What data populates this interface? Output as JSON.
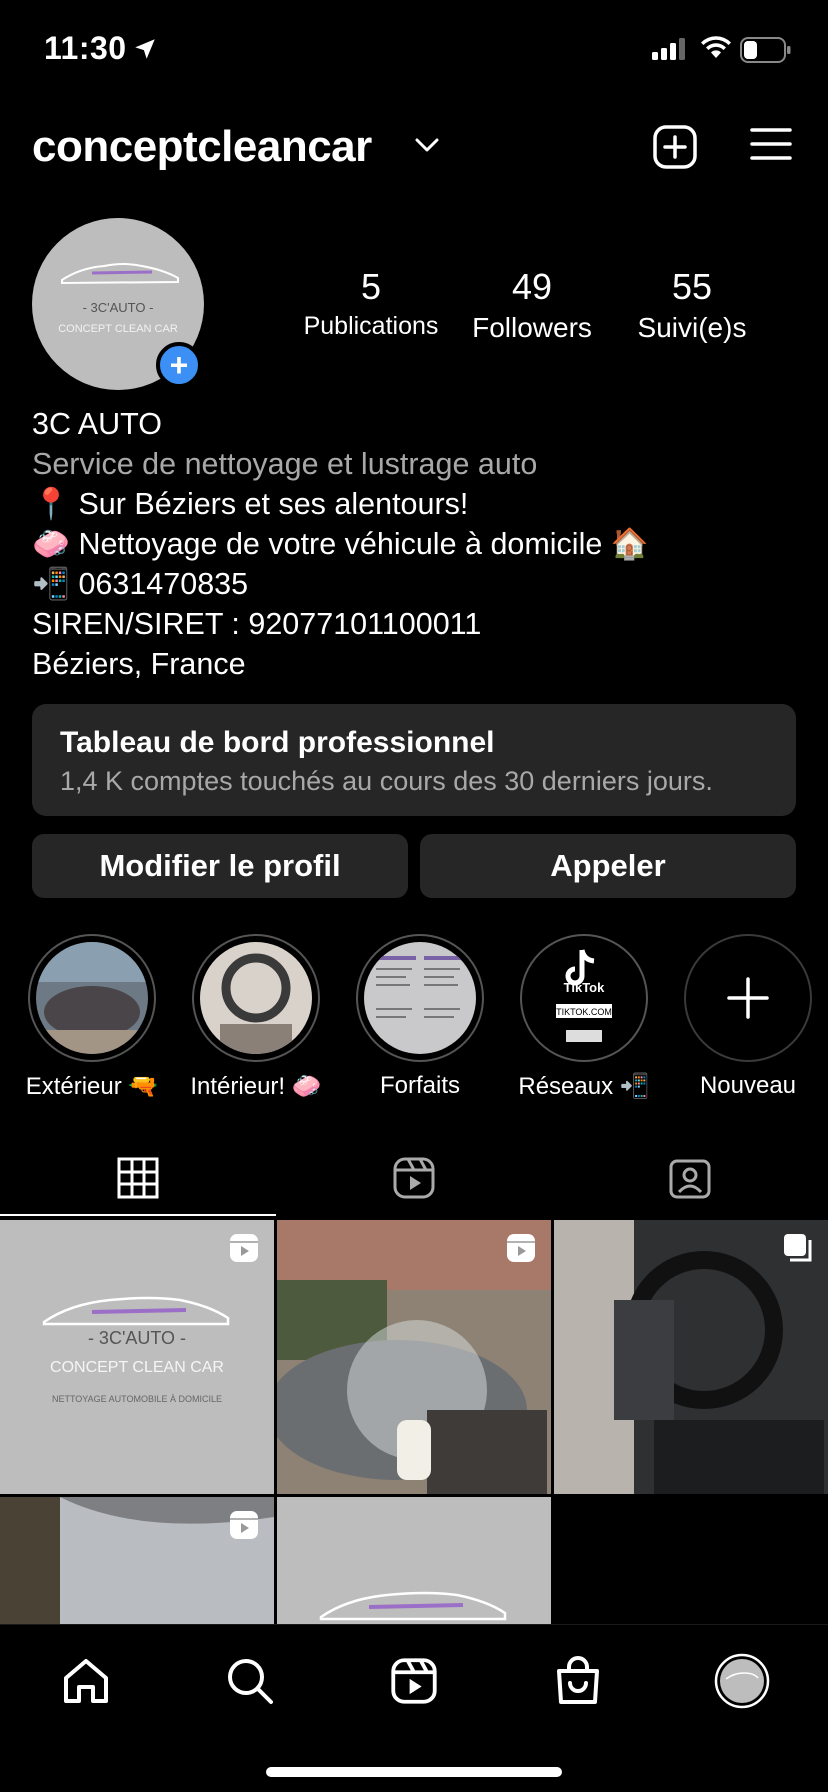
{
  "status": {
    "time": "11:30"
  },
  "header": {
    "username": "conceptcleancar"
  },
  "profile": {
    "avatar_brand": "- 3C'AUTO -",
    "avatar_tagline": "CONCEPT CLEAN CAR",
    "stats": [
      {
        "value": "5",
        "label": "Publications"
      },
      {
        "value": "49",
        "label": "Followers"
      },
      {
        "value": "55",
        "label": "Suivi(e)s"
      }
    ],
    "name": "3C AUTO",
    "category": "Service de nettoyage et lustrage auto",
    "bio_lines": [
      "📍 Sur Béziers et ses alentours!",
      "🧼 Nettoyage de votre véhicule à domicile 🏠",
      "📲 0631470835",
      "SIREN/SIRET : 92077101100011",
      "Béziers, France"
    ]
  },
  "dashboard": {
    "title": "Tableau de bord professionnel",
    "subtitle": "1,4 K comptes touchés au cours des 30 derniers jours."
  },
  "buttons": {
    "edit": "Modifier le profil",
    "call": "Appeler"
  },
  "highlights": [
    {
      "label": "Extérieur 🔫"
    },
    {
      "label": "Intérieur! 🧼"
    },
    {
      "label": "Forfaits"
    },
    {
      "label": "Réseaux 📲"
    },
    {
      "label": "Nouveau"
    }
  ],
  "highlight_art": {
    "tiktok": "TikTok",
    "tiktok_url": "TIKTOK.COM"
  },
  "grid": {
    "logo_brand": "- 3C'AUTO -",
    "logo_tagline": "CONCEPT CLEAN CAR",
    "logo_sub": "NETTOYAGE AUTOMOBILE À DOMICILE"
  },
  "colors": {
    "accent": "#3b8ff5",
    "card": "#262626",
    "muted": "#a8a8a8"
  }
}
